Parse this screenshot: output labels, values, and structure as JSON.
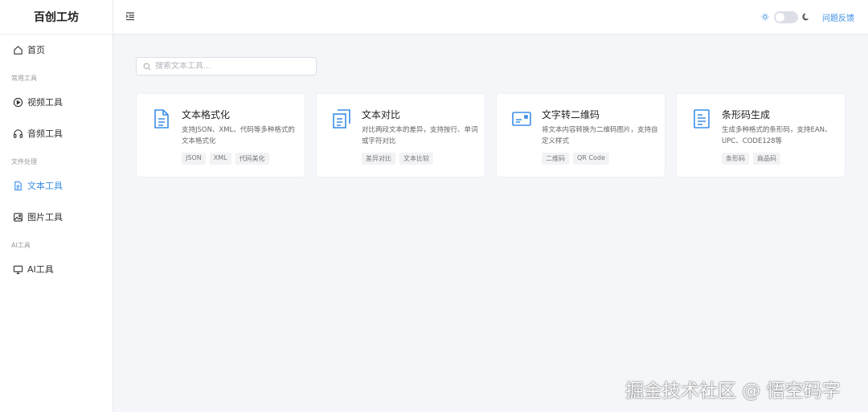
{
  "app": {
    "title": "百创工坊"
  },
  "sidebar": {
    "home": "首页",
    "groups": [
      "常用工具",
      "文件处理",
      "AI工具"
    ],
    "items": [
      {
        "label": "视频工具",
        "icon": "play-circle-icon"
      },
      {
        "label": "音频工具",
        "icon": "headphones-icon"
      },
      {
        "label": "文本工具",
        "icon": "document-icon",
        "active": true
      },
      {
        "label": "图片工具",
        "icon": "image-icon"
      },
      {
        "label": "AI工具",
        "icon": "monitor-icon"
      }
    ]
  },
  "header": {
    "feedback": "问题反馈",
    "theme_toggle": "off"
  },
  "search": {
    "placeholder": "搜索文本工具..."
  },
  "cards": [
    {
      "title": "文本格式化",
      "desc": "支持JSON、XML、代码等多种格式的文本格式化",
      "tags": [
        "JSON",
        "XML",
        "代码美化"
      ],
      "icon": "file-text-icon"
    },
    {
      "title": "文本对比",
      "desc": "对比两段文本的差异，支持按行、单词或字符对比",
      "tags": [
        "差异对比",
        "文本比较"
      ],
      "icon": "copy-document-icon"
    },
    {
      "title": "文字转二维码",
      "desc": "将文本内容转换为二维码图片，支持自定义样式",
      "tags": [
        "二维码",
        "QR Code"
      ],
      "icon": "card-icon"
    },
    {
      "title": "条形码生成",
      "desc": "生成多种格式的条形码，支持EAN、UPC、CODE128等",
      "tags": [
        "条形码",
        "商品码"
      ],
      "icon": "barcode-document-icon"
    }
  ],
  "watermark": "掘金技术社区 @ 悟空码字",
  "colors": {
    "accent": "#3a8ee6",
    "background": "#f4f6f9"
  }
}
